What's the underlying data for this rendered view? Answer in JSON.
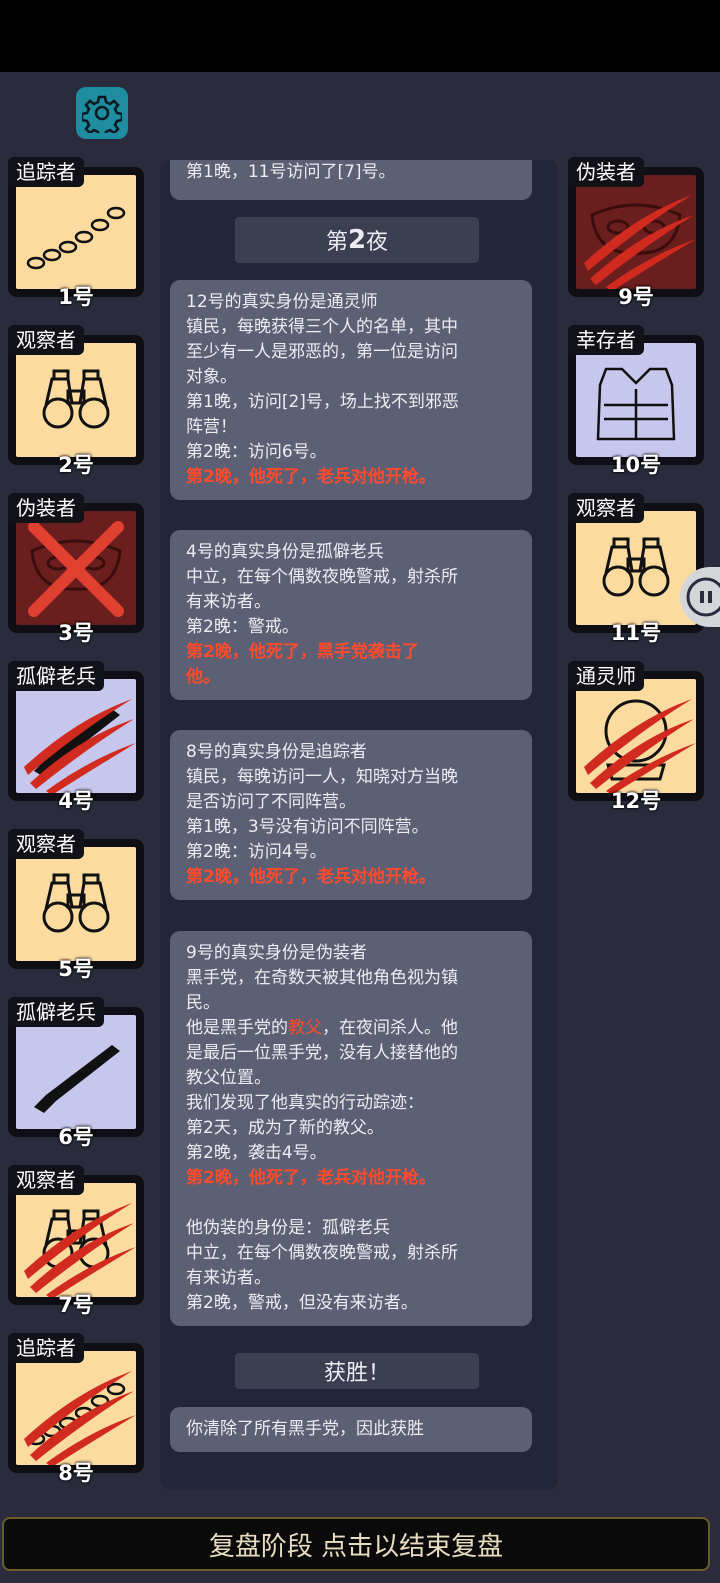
{
  "colors": {
    "tracker_bg": "#fbdba0",
    "watcher_bg": "#fbdba0",
    "disguiser_bg": "#6b1e1e",
    "veteran_bg": "#c7c7ee",
    "survivor_bg": "#c7c7ee",
    "medium_bg": "#fbdba0",
    "highlight": "#ff4a2c"
  },
  "icons": {
    "settings": "gear-icon",
    "side_button": "chat-handle-icon"
  },
  "left_players": [
    {
      "role": "追踪者",
      "number": "1号",
      "icon": "footprints",
      "state": "alive"
    },
    {
      "role": "观察者",
      "number": "2号",
      "icon": "binoculars",
      "state": "alive"
    },
    {
      "role": "伪装者",
      "number": "3号",
      "icon": "mask",
      "state": "executed"
    },
    {
      "role": "孤僻老兵",
      "number": "4号",
      "icon": "rifle",
      "state": "killed"
    },
    {
      "role": "观察者",
      "number": "5号",
      "icon": "binoculars",
      "state": "alive"
    },
    {
      "role": "孤僻老兵",
      "number": "6号",
      "icon": "rifle",
      "state": "alive"
    },
    {
      "role": "观察者",
      "number": "7号",
      "icon": "binoculars",
      "state": "killed"
    },
    {
      "role": "追踪者",
      "number": "8号",
      "icon": "footprints",
      "state": "killed"
    }
  ],
  "right_players": [
    {
      "role": "伪装者",
      "number": "9号",
      "icon": "mask",
      "state": "killed"
    },
    {
      "role": "幸存者",
      "number": "10号",
      "icon": "vest",
      "state": "alive"
    },
    {
      "role": "观察者",
      "number": "11号",
      "icon": "binoculars",
      "state": "alive"
    },
    {
      "role": "通灵师",
      "number": "12号",
      "icon": "crystal-ball",
      "state": "killed"
    }
  ],
  "log": {
    "partial_line": "第1晚，11号访问了[7]号。",
    "night_header_pre": "第",
    "night_header_num": "2",
    "night_header_post": "夜",
    "messages": [
      {
        "lines": [
          "12号的真实身份是通灵师",
          "镇民，每晚获得三个人的名单，其中",
          "至少有一人是邪恶的，第一位是访问",
          "对象。",
          "第1晚，访问[2]号，场上找不到邪恶",
          "阵营！",
          "第2晚：访问6号。"
        ],
        "red": [
          "第2晚，他死了，老兵对他开枪。"
        ]
      },
      {
        "lines": [
          "4号的真实身份是孤僻老兵",
          "中立，在每个偶数夜晚警戒，射杀所",
          "有来访者。",
          "第2晚：警戒。"
        ],
        "red": [
          "第2晚，他死了，黑手党袭击了",
          "他。"
        ]
      },
      {
        "lines": [
          "8号的真实身份是追踪者",
          "镇民，每晚访问一人，知晓对方当晚",
          "是否访问了不同阵营。",
          "第1晚，3号没有访问不同阵营。",
          "第2晚：访问4号。"
        ],
        "red": [
          "第2晚，他死了，老兵对他开枪。"
        ]
      },
      {
        "lines_a": [
          "9号的真实身份是伪装者",
          "黑手党，在奇数天被其他角色视为镇",
          "民。"
        ],
        "godfather_pre": "他是黑手党的",
        "godfather_word": "教父",
        "godfather_post": "，在夜间杀人。他",
        "lines_b": [
          "是最后一位黑手党，没有人接替他的",
          "教父位置。",
          "我们发现了他真实的行动踪迹：",
          "第2天，成为了新的教父。",
          "第2晚，袭击4号。"
        ],
        "red": "第2晚，他死了，老兵对他开枪。",
        "lines_c": [
          "他伪装的身份是：孤僻老兵",
          "中立，在每个偶数夜晚警戒，射杀所",
          "有来访者。",
          "第2晚，警戒，但没有来访者。"
        ]
      }
    ],
    "victory_header": "获胜！",
    "victory_text": "你清除了所有黑手党，因此获胜"
  },
  "footer": {
    "label": "复盘阶段 点击以结束复盘"
  }
}
